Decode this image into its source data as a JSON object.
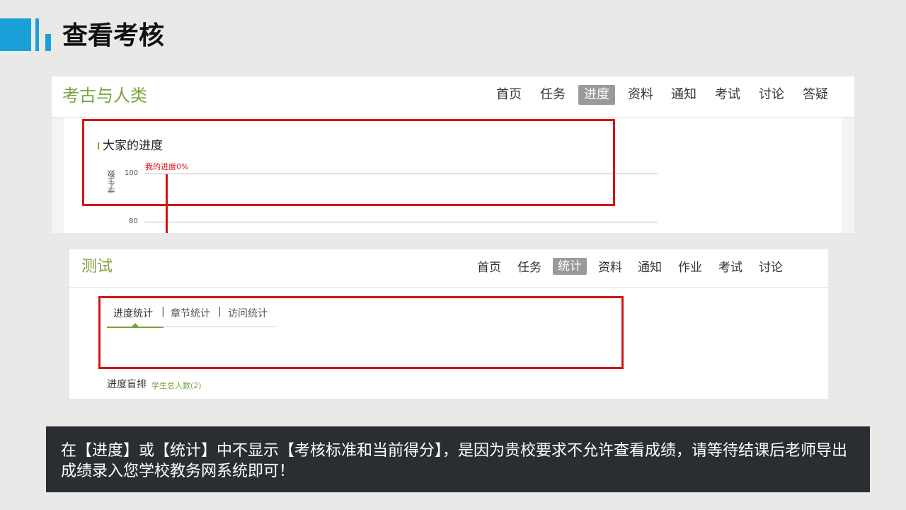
{
  "slide": {
    "title": "查看考核"
  },
  "panel1": {
    "course_title": "考古与人类",
    "nav": [
      "首页",
      "任务",
      "进度",
      "资料",
      "通知",
      "考试",
      "讨论",
      "答疑"
    ],
    "active_nav": "进度",
    "section_title": "大家的进度",
    "chart_data": {
      "type": "bar",
      "ylabel": "学生数",
      "yticks_visible": [
        100,
        80
      ],
      "annotation": "我的进度0%",
      "marker_value_percent": 0
    }
  },
  "panel2": {
    "course_title": "测试",
    "nav": [
      "首页",
      "任务",
      "统计",
      "资料",
      "通知",
      "作业",
      "考试",
      "讨论"
    ],
    "active_nav": "统计",
    "tabs": [
      "进度统计",
      "章节统计",
      "访问统计"
    ],
    "tab_separator": "|",
    "active_tab": "进度统计",
    "rank_title": "进度盲排",
    "rank_count": "学生总人数(2)"
  },
  "notice": {
    "text": "在【进度】或【统计】中不显示【考核标准和当前得分】，是因为贵校要求不允许查看成绩，请等待结课后老师导出成绩录入您学校教务网系统即可！"
  },
  "colors": {
    "accent_blue": "#1aa0d8",
    "brand_green": "#7ba23f",
    "highlight_red": "#d41414",
    "notice_bg": "#2b2e31"
  }
}
